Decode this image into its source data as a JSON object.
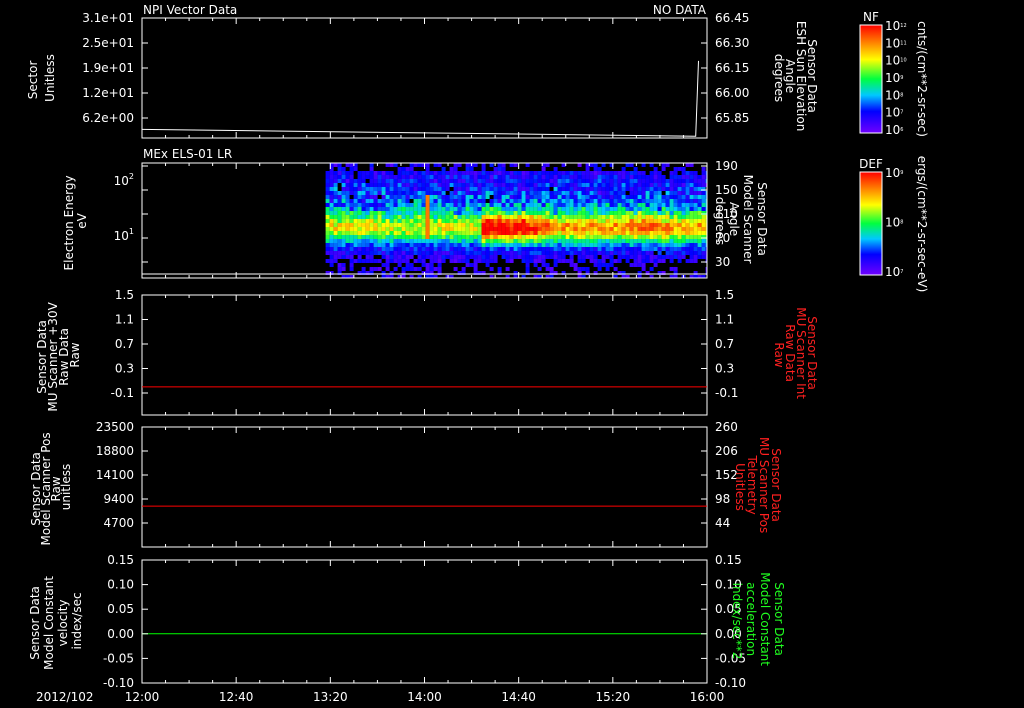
{
  "date_label": "2012/102",
  "time_ticks": [
    "12:00",
    "12:40",
    "13:20",
    "14:00",
    "14:40",
    "15:20",
    "16:00"
  ],
  "chart_data": [
    {
      "type": "line",
      "top_left_label": "NPI Vector Data",
      "top_right_label": "NO DATA",
      "left_axis_label": [
        "Sector",
        "Unitless"
      ],
      "left_ticks": [
        "3.1e+01",
        "2.5e+01",
        "1.9e+01",
        "1.2e+01",
        "6.2e+00"
      ],
      "right_axis_label": [
        "Sensor Data",
        "ESH Sun Elevation",
        "Angle",
        "degrees"
      ],
      "right_ticks": [
        "66.45",
        "66.30",
        "66.15",
        "66.00",
        "65.85"
      ],
      "series": [
        {
          "x_hours": [
            12.0,
            13.0,
            14.0,
            15.0,
            15.92,
            15.94
          ],
          "values": [
            65.8,
            65.79,
            65.78,
            65.77,
            65.76,
            66.2
          ],
          "color": "#ffffff"
        }
      ]
    },
    {
      "type": "heatmap",
      "top_left_label": "MEx ELS-01 LR",
      "left_axis_label": [
        "Electron Energy",
        "eV"
      ],
      "left_ticks": [
        "10",
        "10"
      ],
      "left_tick_exponents": [
        "2",
        "1"
      ],
      "right_axis_label": [
        "Sensor Data",
        "Model Scanner",
        "Angle",
        "degrees"
      ],
      "right_ticks": [
        "190",
        "150",
        "110",
        "70",
        "30"
      ],
      "data_start_time": "13:18",
      "line_series": {
        "value": 5,
        "color": "#ffffff"
      }
    },
    {
      "type": "line",
      "left_axis_label": [
        "Sensor Data",
        "MU Scanner +30V",
        "Raw Data",
        "Raw"
      ],
      "left_ticks": [
        "1.5",
        "1.1",
        "0.7",
        "0.3",
        "-0.1"
      ],
      "right_axis_label": [
        "Sensor Data",
        "MU Scanner Int",
        "Raw Data",
        "Raw"
      ],
      "right_label_color": "#ff2020",
      "right_ticks": [
        "1.5",
        "1.1",
        "0.7",
        "0.3",
        "-0.1"
      ],
      "series": [
        {
          "name": "",
          "value": 0.0,
          "color": "#ff0000"
        }
      ]
    },
    {
      "type": "line",
      "left_axis_label": [
        "Sensor Data",
        "Model Scanner Pos",
        "Raw",
        "unitless"
      ],
      "left_ticks": [
        "23500",
        "18800",
        "14100",
        "9400",
        "4700"
      ],
      "right_axis_label": [
        "Sensor Data",
        "MU Scanner Pos",
        "Telemetry",
        "Unitless"
      ],
      "right_label_color": "#ff2020",
      "right_ticks": [
        "260",
        "206",
        "152",
        "98",
        "44"
      ],
      "series": [
        {
          "name": "",
          "value": 8000,
          "color": "#ff0000"
        }
      ]
    },
    {
      "type": "line",
      "left_axis_label": [
        "Sensor Data",
        "Model Constant",
        "velocity",
        "index/sec"
      ],
      "left_ticks": [
        "0.15",
        "0.10",
        "0.05",
        "0.00",
        "-0.05",
        "-0.10"
      ],
      "right_axis_label": [
        "Sensor Data",
        "Model Constant",
        "acceleration",
        "index/sec**2"
      ],
      "right_label_color": "#20ff20",
      "right_ticks": [
        "0.15",
        "0.10",
        "0.05",
        "0.00",
        "-0.05",
        "-0.10"
      ],
      "series": [
        {
          "name": "",
          "value": 0.0,
          "color": "#00ff00"
        }
      ]
    }
  ],
  "colorbars": [
    {
      "title": "NF",
      "ticks_base": [
        "10",
        "10",
        "10",
        "10",
        "10",
        "10",
        "10"
      ],
      "ticks_exp": [
        "12",
        "11",
        "10",
        "9",
        "8",
        "7",
        "6"
      ],
      "label": "cnts/(cm**2-sr-sec)"
    },
    {
      "title": "DEF",
      "ticks_base": [
        "10",
        "10",
        "10"
      ],
      "ticks_exp": [
        "9",
        "8",
        "7"
      ],
      "label": "ergs/(cm**2-sr-sec-eV)"
    }
  ]
}
